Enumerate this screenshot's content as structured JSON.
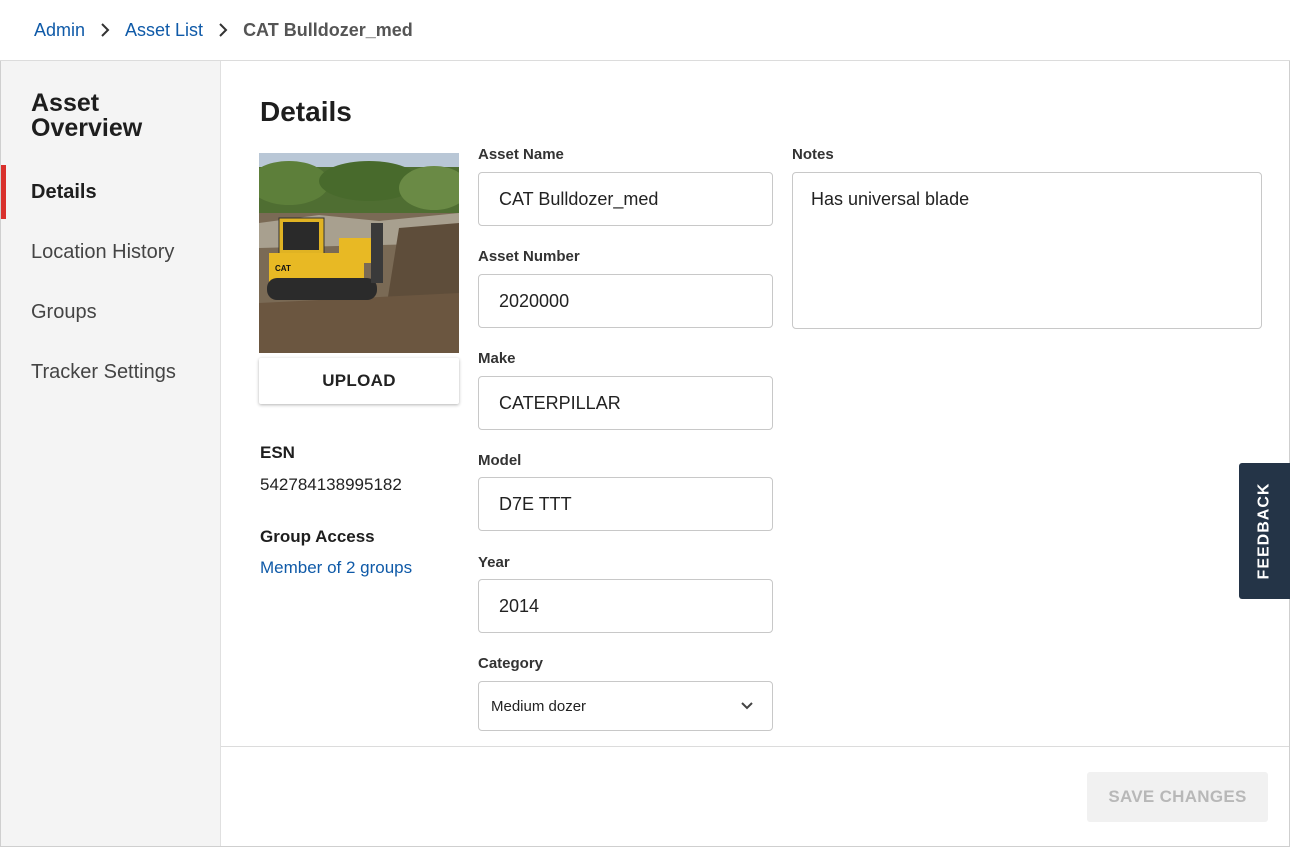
{
  "breadcrumb": {
    "items": [
      {
        "label": "Admin"
      },
      {
        "label": "Asset List"
      }
    ],
    "current": "CAT Bulldozer_med"
  },
  "sidebar": {
    "title": "Asset Overview",
    "items": [
      {
        "label": "Details",
        "active": true
      },
      {
        "label": "Location History",
        "active": false
      },
      {
        "label": "Groups",
        "active": false
      },
      {
        "label": "Tracker Settings",
        "active": false
      }
    ]
  },
  "main": {
    "title": "Details",
    "upload_label": "UPLOAD",
    "esn": {
      "label": "ESN",
      "value": "542784138995182"
    },
    "group_access": {
      "label": "Group Access",
      "link": "Member of 2 groups"
    },
    "fields": {
      "asset_name": {
        "label": "Asset Name",
        "value": "CAT Bulldozer_med"
      },
      "asset_number": {
        "label": "Asset Number",
        "value": "2020000"
      },
      "make": {
        "label": "Make",
        "value": "CATERPILLAR"
      },
      "model": {
        "label": "Model",
        "value": "D7E TTT"
      },
      "year": {
        "label": "Year",
        "value": "2014"
      },
      "category": {
        "label": "Category",
        "selected": "Medium dozer"
      }
    },
    "notes": {
      "label": "Notes",
      "value": "Has universal blade"
    },
    "save_label": "SAVE CHANGES"
  },
  "feedback_label": "FEEDBACK",
  "colors": {
    "link": "#0f5aa8",
    "active_indicator": "#d9302c",
    "feedback_bg": "#243447",
    "sidebar_bg": "#f4f4f4"
  }
}
